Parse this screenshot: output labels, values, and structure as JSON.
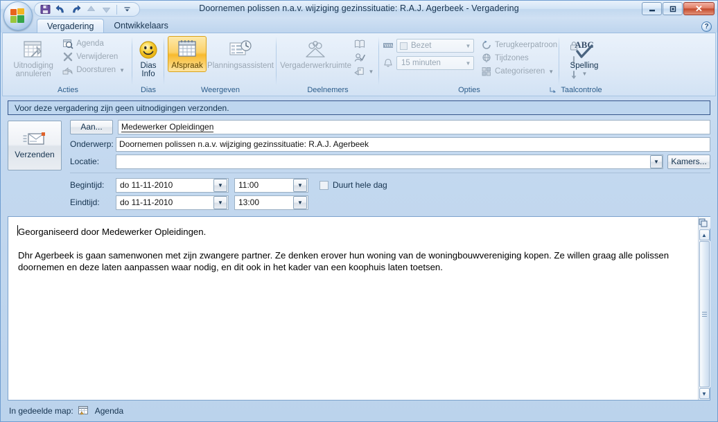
{
  "window": {
    "title": "Doornemen polissen n.a.v. wijziging gezinssituatie: R.A.J. Agerbeek  - Vergadering",
    "minimize_label": "–",
    "restore_label": "❐",
    "close_label": "✕",
    "help_label": "?"
  },
  "quick_access": {
    "items": [
      {
        "name": "save-icon",
        "title": "Opslaan"
      },
      {
        "name": "undo-icon",
        "title": "Ongedaan maken"
      },
      {
        "name": "redo-icon",
        "title": "Opnieuw"
      },
      {
        "name": "previous-item-icon",
        "title": "Vorig item"
      },
      {
        "name": "next-item-icon",
        "title": "Volgend item"
      },
      {
        "name": "customize-qat-icon",
        "title": "Werkbalk Snelle toegang aanpassen"
      }
    ]
  },
  "tabs": [
    {
      "label": "Vergadering",
      "active": true
    },
    {
      "label": "Ontwikkelaars",
      "active": false
    }
  ],
  "ribbon": {
    "groups": [
      {
        "label": "Acties",
        "big": [
          {
            "line1": "Uitnodiging",
            "line2": "annuleren",
            "icon": "cancel-invitation-icon",
            "disabled": true
          }
        ],
        "small": [
          {
            "label": "Agenda",
            "icon": "calendar-icon",
            "disabled": true,
            "caret": false
          },
          {
            "label": "Verwijderen",
            "icon": "delete-icon",
            "disabled": true,
            "caret": false
          },
          {
            "label": "Doorsturen",
            "icon": "forward-icon",
            "disabled": true,
            "caret": true
          }
        ]
      },
      {
        "label": "Dias",
        "big": [
          {
            "line1": "Dias",
            "line2": "Info",
            "icon": "smiley-icon",
            "disabled": false
          }
        ],
        "small": []
      },
      {
        "label": "Weergeven",
        "big": [
          {
            "line1": "Afspraak",
            "line2": "",
            "icon": "appointment-icon",
            "selected": true
          },
          {
            "line1": "Planningsassistent",
            "line2": "",
            "icon": "scheduling-assistant-icon",
            "disabled": true
          }
        ],
        "small": []
      },
      {
        "label": "Deelnemers",
        "big": [
          {
            "line1": "Vergaderwerkruimte",
            "line2": "",
            "icon": "meeting-workspace-icon",
            "disabled": true
          }
        ],
        "small": [
          {
            "label": "",
            "icon": "address-book-icon",
            "disabled": true,
            "caret": false
          },
          {
            "label": "",
            "icon": "check-names-icon",
            "disabled": true,
            "caret": false
          },
          {
            "label": "",
            "icon": "response-options-icon",
            "disabled": true,
            "caret": true
          }
        ]
      },
      {
        "label": "Opties",
        "combos": [
          {
            "name": "show-as-combo",
            "value": "Bezet",
            "icon": "show-as-icon"
          },
          {
            "name": "reminder-combo",
            "value": "15 minuten",
            "icon": "reminder-icon"
          }
        ],
        "small": [
          {
            "label": "Terugkeerpatroon",
            "icon": "recurrence-icon",
            "disabled": true,
            "caret": false
          },
          {
            "label": "Tijdzones",
            "icon": "time-zones-icon",
            "disabled": true,
            "caret": false
          },
          {
            "label": "Categoriseren",
            "icon": "categorize-icon",
            "disabled": true,
            "caret": true
          }
        ],
        "tiny": [
          {
            "name": "private-icon"
          },
          {
            "name": "high-importance-icon"
          },
          {
            "name": "low-importance-icon"
          }
        ],
        "dialog_launcher": "⤵"
      },
      {
        "label": "Taalcontrole",
        "big": [
          {
            "line1": "Spelling",
            "line2": "",
            "icon": "spelling-icon",
            "caret": true
          }
        ],
        "small": []
      }
    ]
  },
  "infobar": {
    "message": "Voor deze vergadering zijn geen uitnodigingen verzonden."
  },
  "form": {
    "send_button": {
      "label": "Verzenden",
      "icon": "send-envelope-icon"
    },
    "to": {
      "button_label": "Aan...",
      "value": "Medewerker Opleidingen"
    },
    "subject": {
      "label": "Onderwerp:",
      "value": "Doornemen polissen n.a.v. wijziging gezinssituatie: R.A.J. Agerbeek"
    },
    "location": {
      "label": "Locatie:",
      "value": "",
      "rooms_button": "Kamers..."
    },
    "start": {
      "label": "Begintijd:",
      "date": "do 11-11-2010",
      "time": "11:00"
    },
    "end": {
      "label": "Eindtijd:",
      "date": "do 11-11-2010",
      "time": "13:00"
    },
    "all_day": {
      "label": "Duurt hele dag",
      "checked": false
    }
  },
  "body": {
    "paragraphs": [
      "Georganiseerd door Medewerker Opleidingen.",
      "Dhr Agerbeek is gaan samenwonen met zijn zwangere partner. Ze denken erover hun woning van de woningbouwvereniging kopen. Ze willen graag alle polissen doornemen en deze laten aanpassen waar nodig, en dit ook in het kader van een koophuis laten toetsen."
    ]
  },
  "status": {
    "label": "In gedeelde map:",
    "folder": "Agenda",
    "icon": "shared-calendar-icon"
  },
  "colors": {
    "accent": "#1b4b7d",
    "selected": "#f8ba2e",
    "close": "#c34b2e",
    "infobar_border": "#34548a"
  }
}
